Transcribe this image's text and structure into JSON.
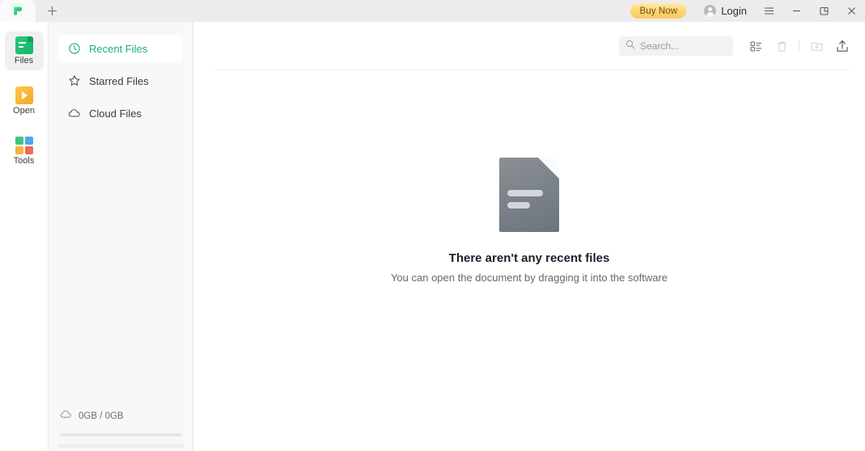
{
  "titlebar": {
    "logo_icon": "app-logo-green-bubble",
    "new_tab_icon": "plus-icon",
    "buy_now_label": "Buy Now",
    "login_label": "Login",
    "avatar_icon": "user-avatar-icon",
    "menu_icon": "hamburger-menu-icon",
    "minimize_icon": "minimize-icon",
    "maximize_icon": "restore-window-icon",
    "close_icon": "close-icon"
  },
  "rail": {
    "items": [
      {
        "label": "Files",
        "icon": "files-icon",
        "active": true
      },
      {
        "label": "Open",
        "icon": "open-icon",
        "active": false
      },
      {
        "label": "Tools",
        "icon": "tools-icon",
        "active": false
      }
    ],
    "tools_colors": [
      "#3fc77f",
      "#4aa8e8",
      "#f5b13c",
      "#f06a4c"
    ]
  },
  "nav": {
    "items": [
      {
        "label": "Recent Files",
        "icon": "clock-icon",
        "active": true
      },
      {
        "label": "Starred Files",
        "icon": "star-icon",
        "active": false
      },
      {
        "label": "Cloud Files",
        "icon": "cloud-icon",
        "active": false
      }
    ],
    "storage": {
      "icon": "cloud-icon",
      "text": "0GB / 0GB",
      "used_percent": 0
    }
  },
  "toolbar": {
    "search_placeholder": "Search...",
    "search_value": "",
    "search_icon": "search-icon",
    "list_view_icon": "list-view-icon",
    "delete_icon": "trash-icon",
    "new_folder_icon": "new-folder-icon",
    "upload_icon": "upload-share-icon"
  },
  "empty_state": {
    "icon": "document-placeholder-icon",
    "title": "There aren't any recent files",
    "subtitle": "You can open the document by dragging it into the software"
  },
  "colors": {
    "accent_green": "#19b26d",
    "buy_now_gold": "#ffd66e",
    "titlebar_bg": "#ececec",
    "nav_bg": "#f7f8f9"
  }
}
